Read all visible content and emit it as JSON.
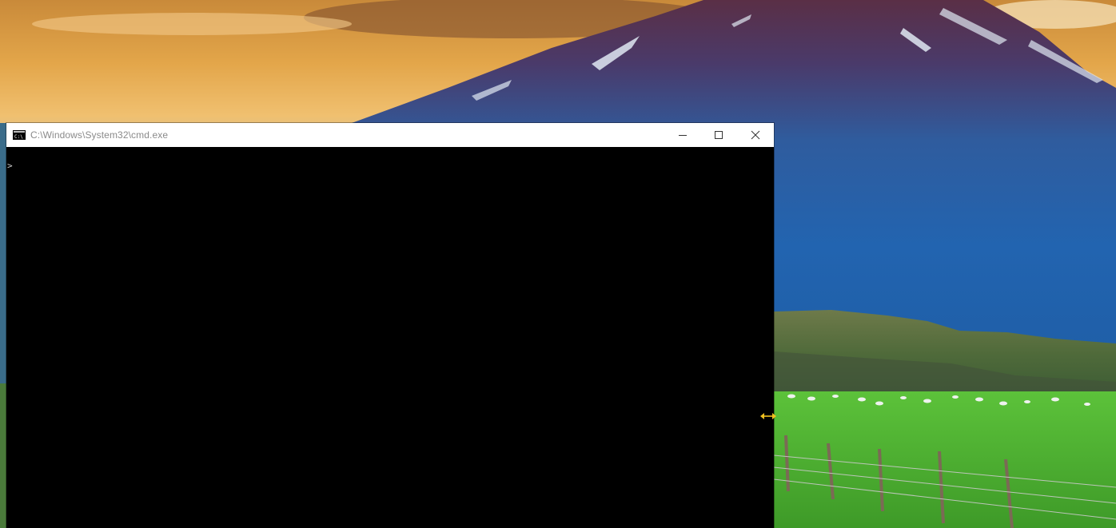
{
  "window": {
    "title": "C:\\Windows\\System32\\cmd.exe",
    "icon": "cmd-icon",
    "controls": {
      "minimize": "minimize-icon",
      "maximize": "maximize-icon",
      "close": "close-icon"
    }
  },
  "console": {
    "prompt_text": ">",
    "background": "#000000",
    "text_color": "#cccccc"
  },
  "cursor": {
    "icon": "horizontal-resize-cursor-icon",
    "color": "#f0c020"
  },
  "wallpaper": {
    "description_icon": "mountain-landscape-wallpaper"
  }
}
